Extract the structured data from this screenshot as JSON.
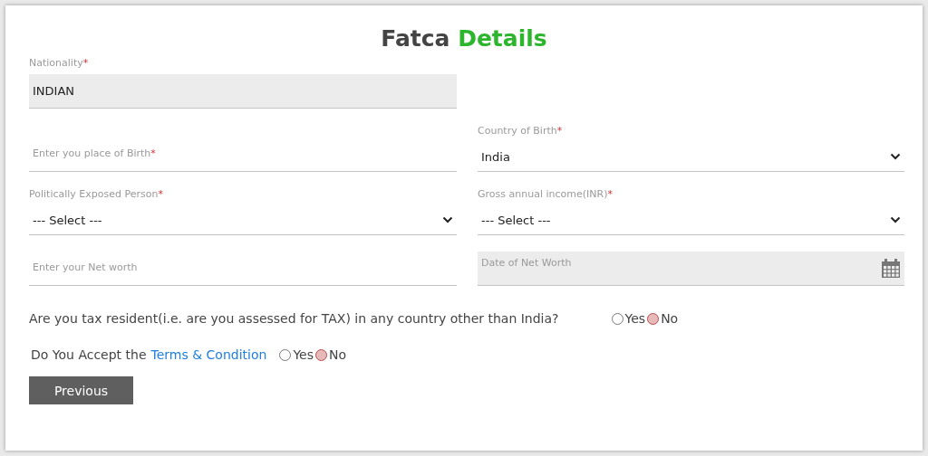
{
  "title": [
    {
      "text": "Fatca",
      "accent": false
    },
    {
      "text": "Details",
      "accent": true
    }
  ],
  "rows": [
    {
      "left": {
        "kind": "text",
        "label": "Nationality",
        "required_mark": "*",
        "value": "INDIAN",
        "disabled": true
      }
    },
    {
      "left": {
        "kind": "text",
        "label": "Enter you place of Birth",
        "required_mark": "*",
        "disabled": false
      },
      "right": {
        "kind": "select",
        "label": "Country of Birth",
        "required_mark": "*",
        "value": "India",
        "disabled": false
      }
    },
    {
      "left": {
        "kind": "select",
        "label": "Politically Exposed Person",
        "required_mark": "*",
        "value": "--- Select ---",
        "disabled": false
      },
      "right": {
        "kind": "select",
        "label": "Gross annual income(INR)",
        "required_mark": "*",
        "value": "--- Select ---",
        "disabled": false
      }
    },
    {
      "left": {
        "kind": "text",
        "label": "Enter your Net worth",
        "disabled": false
      },
      "right": {
        "kind": "date",
        "label": "Date of Net Worth",
        "disabled": true
      }
    }
  ],
  "questions": [
    {
      "text": "Are you tax resident(i.e. are you assessed for TAX) in any country other than India?",
      "options": [
        {
          "label": "Yes",
          "selected": false
        },
        {
          "label": "No",
          "selected": true
        }
      ]
    },
    {
      "text": "Do You Accept the",
      "link": "Terms & Condition",
      "options": [
        {
          "label": "Yes",
          "selected": false
        },
        {
          "label": "No",
          "selected": true
        }
      ]
    }
  ],
  "buttons": [
    {
      "label": "Previous"
    }
  ]
}
